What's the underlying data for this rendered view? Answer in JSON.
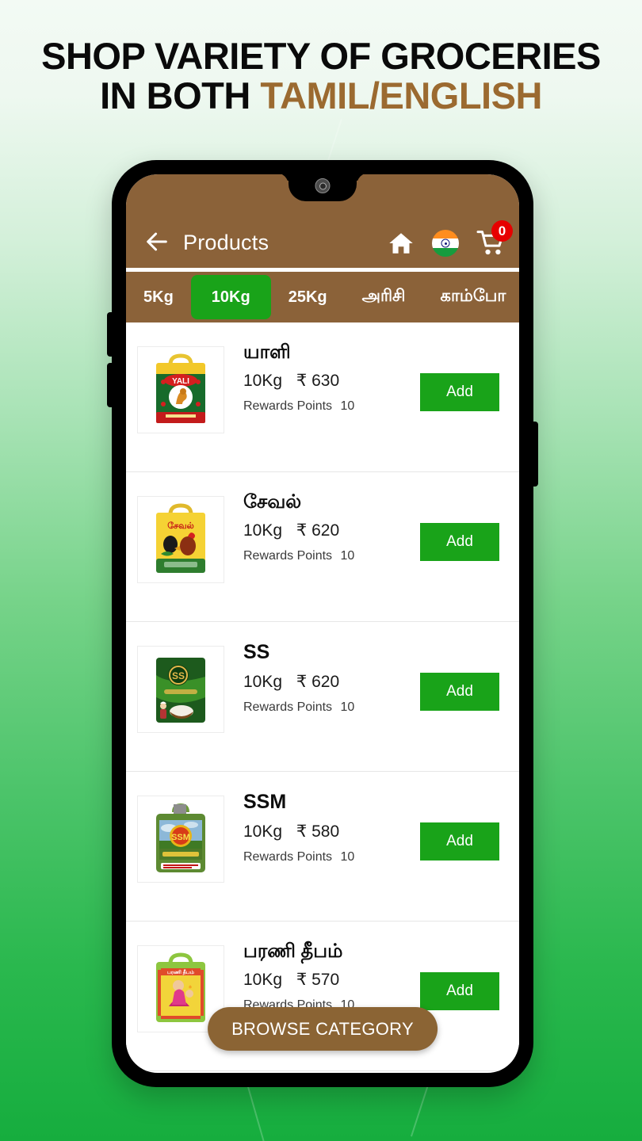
{
  "headline": {
    "line1": "SHOP VARIETY OF GROCERIES",
    "line2_plain": "IN BOTH ",
    "line2_accent": "TAMIL/ENGLISH",
    "accent_color": "#9b6a30",
    "text_color": "#0a0a0a"
  },
  "theme": {
    "brand_brown": "#8b6239",
    "accent_green": "#19a319",
    "badge_red": "#e60000",
    "background_top": "#f3faf4",
    "background_bottom": "#16ad3e"
  },
  "appbar": {
    "back_icon": "arrow-left-icon",
    "title": "Products",
    "home_icon": "home-icon",
    "flag_icon": "india-flag-icon",
    "cart_icon": "shopping-cart-icon",
    "cart_count": "0"
  },
  "tabs": [
    {
      "label": "5Kg",
      "active": false
    },
    {
      "label": "10Kg",
      "active": true
    },
    {
      "label": "25Kg",
      "active": false
    },
    {
      "label": "அரிசி",
      "active": false
    },
    {
      "label": "காம்போ",
      "active": false
    }
  ],
  "labels": {
    "rewards_points": "Rewards Points",
    "add_button": "Add",
    "currency": "₹"
  },
  "products": [
    {
      "name": "யாளி",
      "weight": "10Kg",
      "price": "₹ 630",
      "rewards_label": "Rewards Points",
      "rewards_value": "10",
      "add_label": "Add",
      "thumb": "rice-bag-yali"
    },
    {
      "name": "சேவல்",
      "weight": "10Kg",
      "price": "₹ 620",
      "rewards_label": "Rewards Points",
      "rewards_value": "10",
      "add_label": "Add",
      "thumb": "rice-bag-seval"
    },
    {
      "name": "SS",
      "weight": "10Kg",
      "price": "₹ 620",
      "rewards_label": "Rewards Points",
      "rewards_value": "10",
      "add_label": "Add",
      "thumb": "rice-bag-ss"
    },
    {
      "name": "SSM",
      "weight": "10Kg",
      "price": "₹ 580",
      "rewards_label": "Rewards Points",
      "rewards_value": "10",
      "add_label": "Add",
      "thumb": "rice-bag-ssm"
    },
    {
      "name": "பரணி தீபம்",
      "weight": "10Kg",
      "price": "₹ 570",
      "rewards_label": "Rewards Points",
      "rewards_value": "10",
      "add_label": "Add",
      "thumb": "rice-bag-parani-deepam"
    }
  ],
  "browse_button": {
    "label": "BROWSE CATEGORY"
  }
}
